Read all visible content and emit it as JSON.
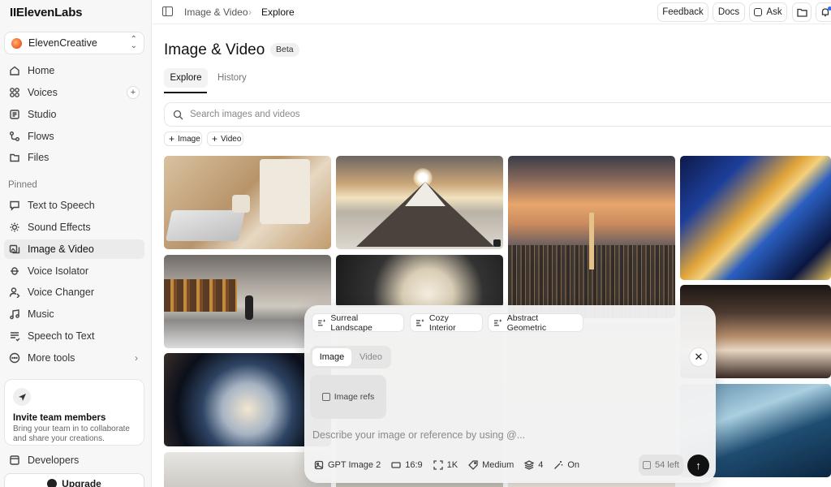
{
  "app": {
    "logo": "IIElevenLabs"
  },
  "workspace": {
    "name": "ElevenCreative"
  },
  "sidebar": {
    "main_items": [
      {
        "label": "Home",
        "icon": "home-icon"
      },
      {
        "label": "Voices",
        "icon": "voices-icon",
        "badge": "+"
      },
      {
        "label": "Studio",
        "icon": "studio-icon"
      },
      {
        "label": "Flows",
        "icon": "flows-icon"
      },
      {
        "label": "Files",
        "icon": "files-icon"
      }
    ],
    "pinned_title": "Pinned",
    "pinned_items": [
      {
        "label": "Text to Speech",
        "icon": "text-to-speech-icon"
      },
      {
        "label": "Sound Effects",
        "icon": "sound-effects-icon"
      },
      {
        "label": "Image & Video",
        "icon": "image-video-icon",
        "active": true
      },
      {
        "label": "Voice Isolator",
        "icon": "voice-isolator-icon"
      },
      {
        "label": "Voice Changer",
        "icon": "voice-changer-icon"
      },
      {
        "label": "Music",
        "icon": "music-icon"
      },
      {
        "label": "Speech to Text",
        "icon": "speech-to-text-icon"
      },
      {
        "label": "More tools",
        "icon": "more-tools-icon",
        "chevron": "›"
      }
    ],
    "invite": {
      "title": "Invite team members",
      "text": "Bring your team in to collaborate and share your creations."
    },
    "developers": "Developers",
    "upgrade": "Upgrade"
  },
  "topbar": {
    "breadcrumb": [
      "Image & Video",
      "Explore"
    ],
    "separator": "›",
    "feedback": "Feedback",
    "docs": "Docs",
    "ask": "Ask"
  },
  "page": {
    "title": "Image & Video",
    "badge": "Beta",
    "tabs": [
      "Explore",
      "History"
    ],
    "search_placeholder": "Search images and videos",
    "filters": [
      "Image",
      "Video"
    ]
  },
  "composer": {
    "suggestions": [
      "Surreal Landscape",
      "Cozy Interior",
      "Abstract Geometric"
    ],
    "modes": [
      "Image",
      "Video"
    ],
    "image_refs": "Image refs",
    "prompt_placeholder": "Describe your image or reference by using @...",
    "options": {
      "model": "GPT Image 2",
      "aspect": "16:9",
      "resolution": "1K",
      "quality": "Medium",
      "count": "4",
      "enhance": "On"
    },
    "credits_left": "54 left"
  },
  "colors": {
    "accent": "#111111",
    "active_nav": "#ebebeb",
    "notification": "#2f6bff"
  }
}
